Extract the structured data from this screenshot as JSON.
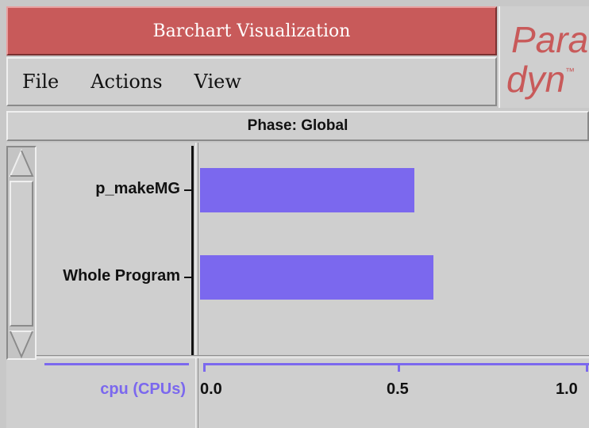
{
  "window": {
    "title": "Barchart Visualization"
  },
  "logo": {
    "line1": "Para",
    "line2": "dyn",
    "mark": "™",
    "color": "#c85a5a"
  },
  "menu": {
    "items": [
      "File",
      "Actions",
      "View"
    ]
  },
  "phase": {
    "label": "Phase: Global"
  },
  "scrollbar": {
    "up_icon": "triangle-up-icon",
    "down_icon": "triangle-down-icon"
  },
  "colors": {
    "title_bar": "#c85a5a",
    "bar": "#7b68ee",
    "background": "#c8c8c8"
  },
  "chart_data": {
    "type": "bar",
    "orientation": "horizontal",
    "categories": [
      "p_makeMG",
      "Whole Program"
    ],
    "values": [
      0.55,
      0.6
    ],
    "metric": "cpu (CPUs)",
    "xlim": [
      0.0,
      1.0
    ],
    "ticks": [
      "0.0",
      "0.5",
      "1.0"
    ]
  }
}
